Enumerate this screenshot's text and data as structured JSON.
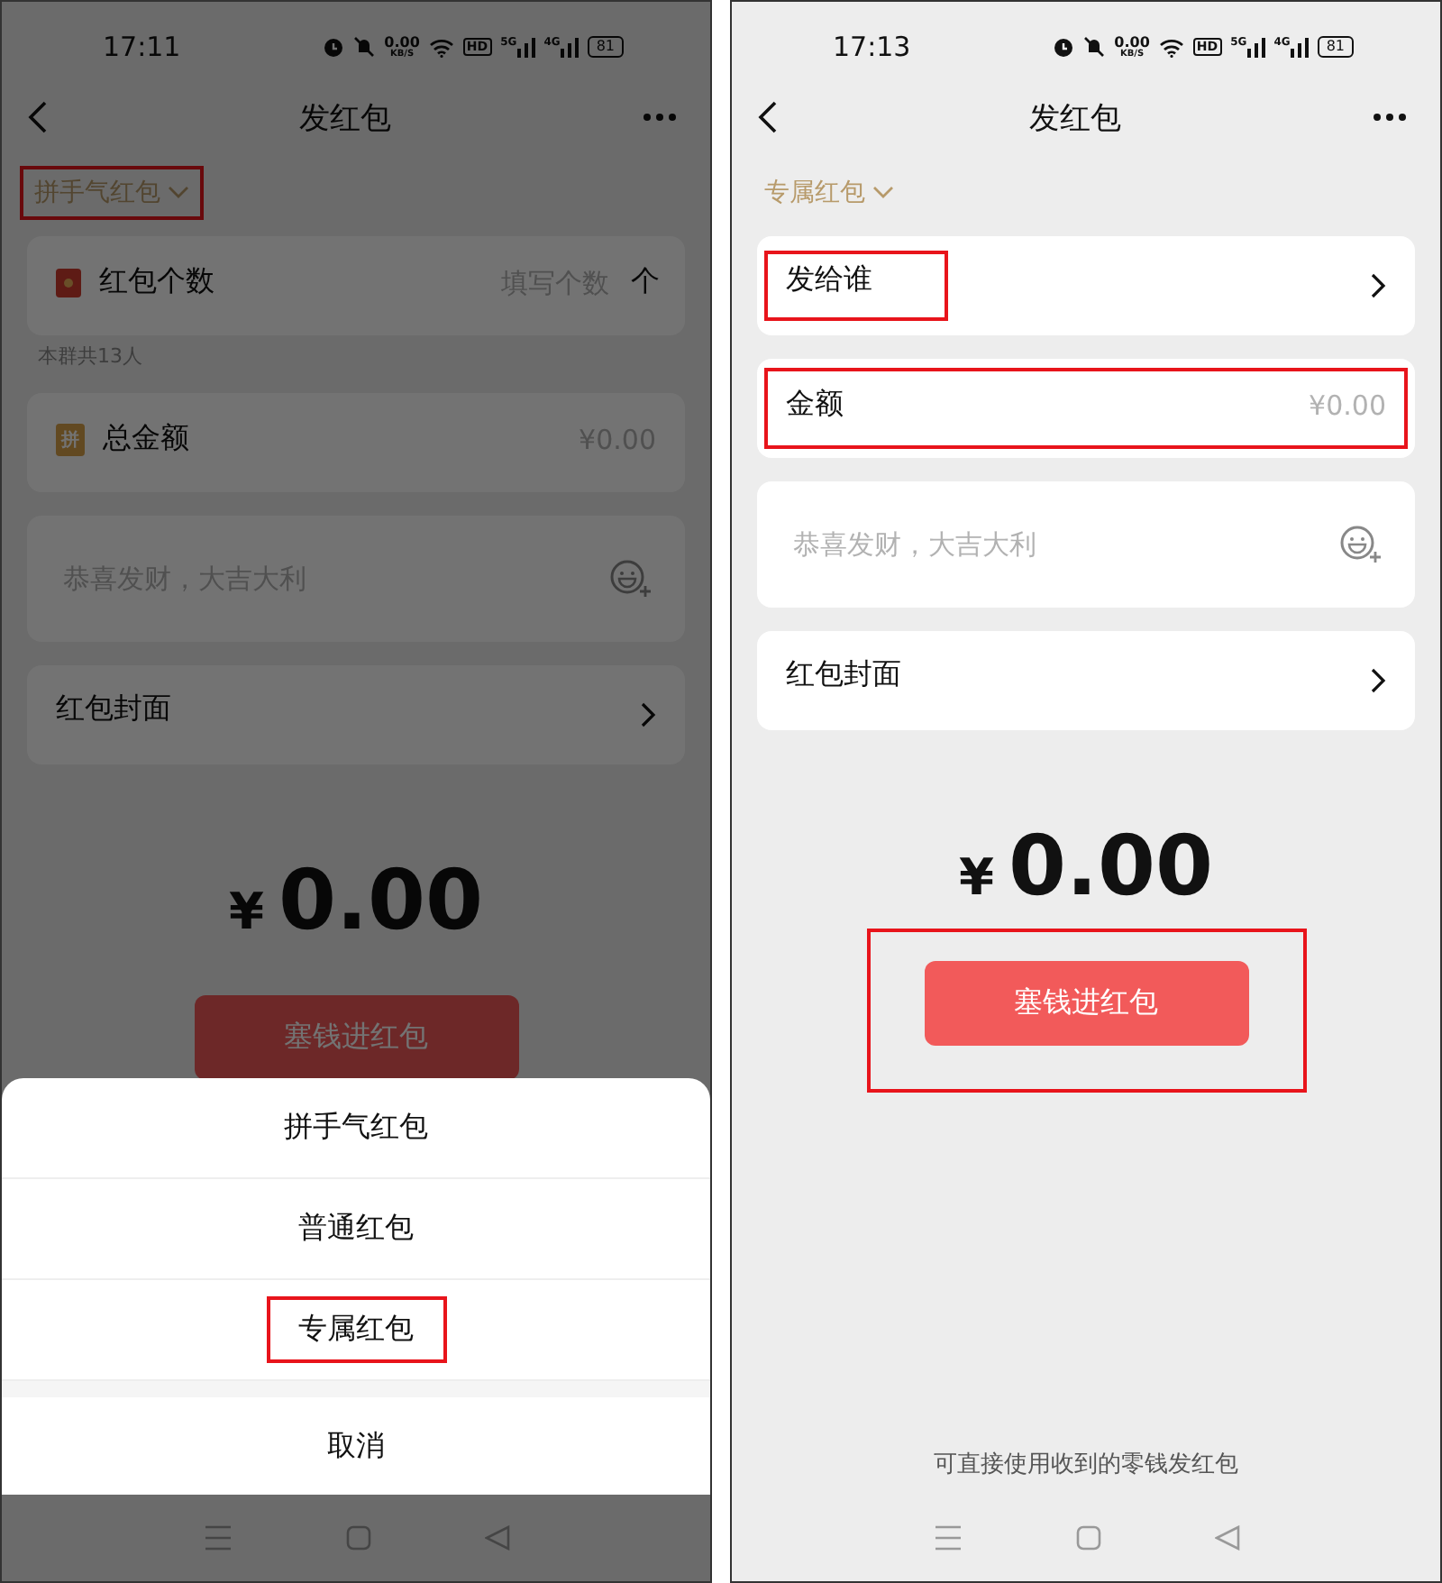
{
  "screens": [
    {
      "status_bar": {
        "time": "17:11",
        "speed": "0.00",
        "speed_unit": "KB/S",
        "hd": "HD",
        "net1": "5G",
        "net2": "4G",
        "battery": "81"
      },
      "nav": {
        "title": "发红包"
      },
      "type_selector": {
        "label": "拼手气红包",
        "highlighted": true
      },
      "fields": [
        {
          "kind": "count",
          "label": "红包个数",
          "placeholder": "填写个数",
          "unit": "个",
          "hint": "本群共13人",
          "highlighted": false
        },
        {
          "kind": "amount",
          "badge": "拼",
          "label": "总金额",
          "placeholder": "¥0.00",
          "highlighted": false
        },
        {
          "kind": "message",
          "placeholder": "恭喜发财，大吉大利",
          "highlighted": false
        },
        {
          "kind": "link",
          "label": "红包封面",
          "highlighted": false
        }
      ],
      "amount": {
        "currency": "¥",
        "value": "0.00"
      },
      "submit": {
        "label": "塞钱进红包",
        "highlighted": false
      },
      "action_sheet": {
        "options": [
          {
            "label": "拼手气红包",
            "highlighted": false
          },
          {
            "label": "普通红包",
            "highlighted": false
          },
          {
            "label": "专属红包",
            "highlighted": true
          }
        ],
        "cancel": "取消"
      }
    },
    {
      "status_bar": {
        "time": "17:13",
        "speed": "0.00",
        "speed_unit": "KB/S",
        "hd": "HD",
        "net1": "5G",
        "net2": "4G",
        "battery": "81"
      },
      "nav": {
        "title": "发红包"
      },
      "type_selector": {
        "label": "专属红包",
        "highlighted": false
      },
      "fields": [
        {
          "kind": "link",
          "label": "发给谁",
          "highlighted": true
        },
        {
          "kind": "amount",
          "label": "金额",
          "placeholder": "¥0.00",
          "highlighted": true
        },
        {
          "kind": "message",
          "placeholder": "恭喜发财，大吉大利",
          "highlighted": false
        },
        {
          "kind": "link",
          "label": "红包封面",
          "highlighted": false
        }
      ],
      "amount": {
        "currency": "¥",
        "value": "0.00"
      },
      "submit": {
        "label": "塞钱进红包",
        "highlighted": true
      },
      "footnote": "可直接使用收到的零钱发红包"
    }
  ]
}
